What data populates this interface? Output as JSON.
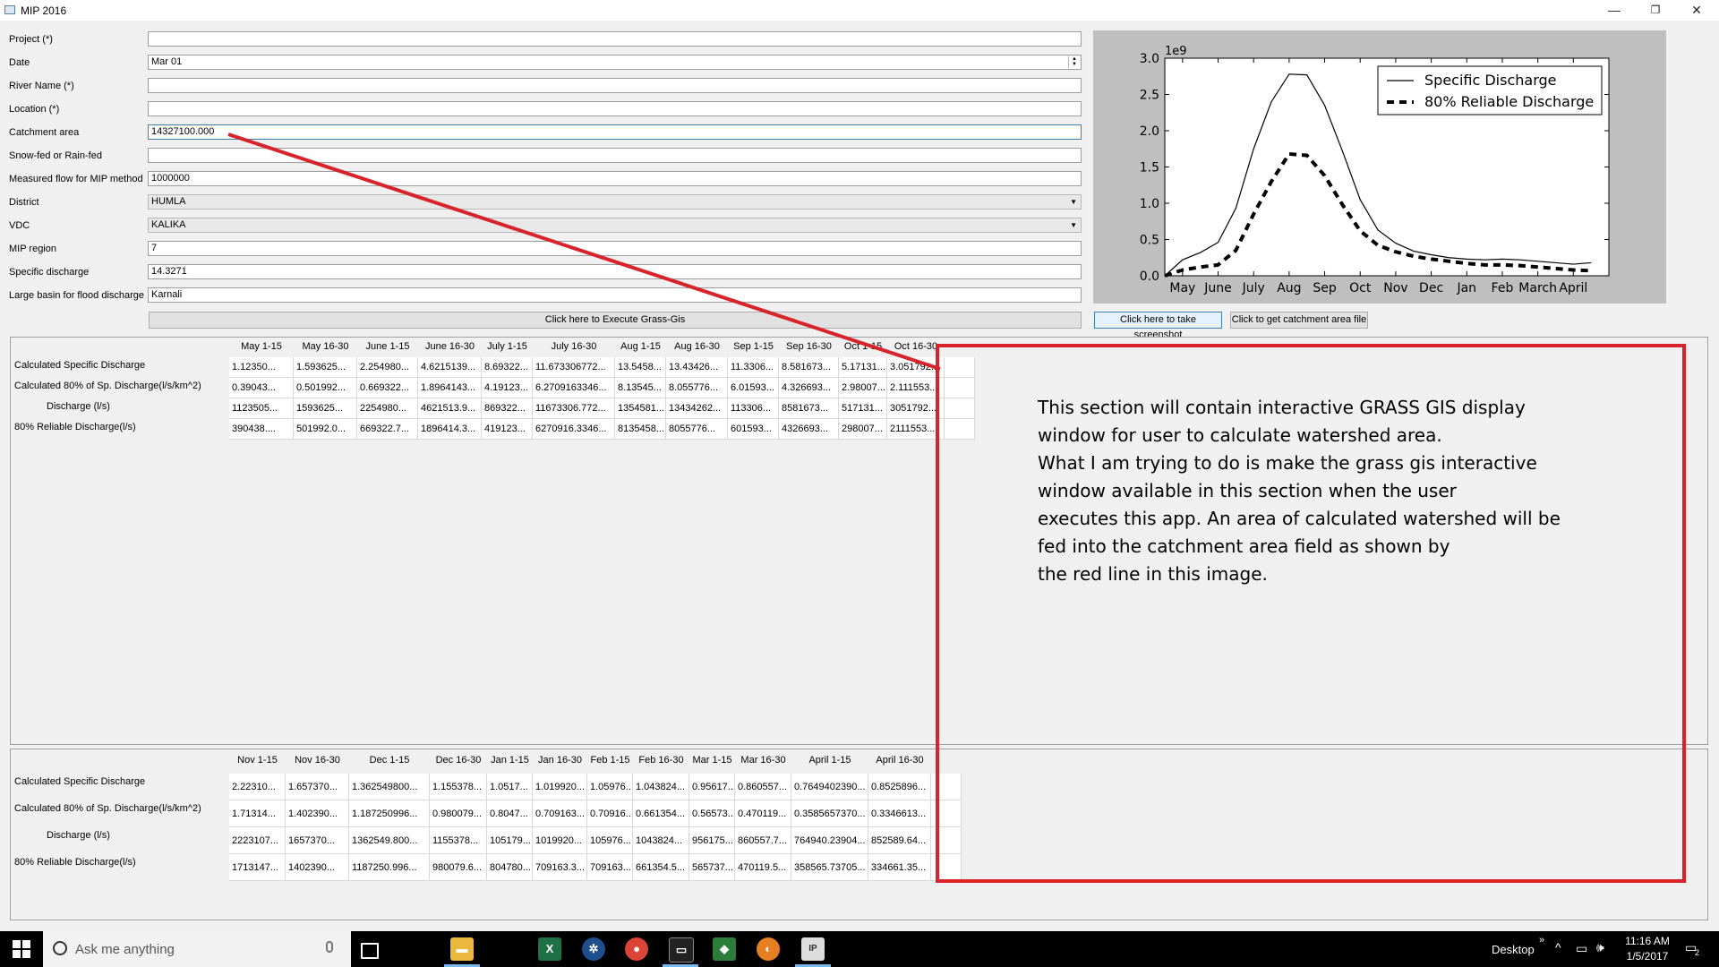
{
  "window": {
    "title": "MIP 2016",
    "minimize": "—",
    "restore": "❐",
    "close": "✕"
  },
  "form": {
    "project_label": "Project (*)",
    "project_value": "",
    "date_label": "Date",
    "date_value": "Mar 01",
    "river_label": "River Name (*)",
    "river_value": "",
    "location_label": "Location (*)",
    "location_value": "",
    "catchment_label": "Catchment area",
    "catchment_value": "14327100.000",
    "snowfed_label": "Snow-fed or Rain-fed",
    "snowfed_value": "",
    "measured_label": "Measured flow for MIP method",
    "measured_value": "1000000",
    "district_label": "District",
    "district_value": "HUMLA",
    "vdc_label": "VDC",
    "vdc_value": "KALIKA",
    "mip_label": "MIP region",
    "mip_value": "7",
    "specific_label": "Specific discharge",
    "specific_value": "14.3271",
    "basin_label": "Large basin for flood discharge",
    "basin_value": "Karnali"
  },
  "buttons": {
    "execute": "Click here to Execute Grass-Gis",
    "screenshot": "Click here to take screenshot",
    "catchment_file": "Click to get catchment area file"
  },
  "chart_data": {
    "type": "line",
    "title": "",
    "xlabel": "",
    "ylabel": "",
    "y_offset_label": "1e9",
    "categories": [
      "May",
      "June",
      "July",
      "Aug",
      "Sep",
      "Oct",
      "Nov",
      "Dec",
      "Jan",
      "Feb",
      "March",
      "April"
    ],
    "x_tick_positions": [
      1,
      3,
      5,
      7,
      9,
      11,
      13,
      15,
      17,
      19,
      21,
      23
    ],
    "y_ticks": [
      "0.0",
      "0.5",
      "1.0",
      "1.5",
      "2.0",
      "2.5",
      "3.0"
    ],
    "ylim": [
      0,
      3.0
    ],
    "xlim": [
      0,
      25
    ],
    "legend_position": "top-right",
    "series": [
      {
        "name": "Specific Discharge",
        "style": "solid",
        "x": [
          0,
          1,
          2,
          3,
          4,
          5,
          6,
          7,
          8,
          9,
          10,
          11,
          12,
          13,
          14,
          15,
          16,
          17,
          18,
          19,
          20,
          21,
          22,
          23,
          24
        ],
        "values": [
          0.0,
          0.22,
          0.32,
          0.46,
          0.93,
          1.75,
          2.4,
          2.78,
          2.77,
          2.35,
          1.72,
          1.05,
          0.63,
          0.45,
          0.34,
          0.29,
          0.25,
          0.23,
          0.22,
          0.23,
          0.22,
          0.2,
          0.18,
          0.16,
          0.18
        ]
      },
      {
        "name": "80% Reliable Discharge",
        "style": "dashed",
        "x": [
          0,
          1,
          2,
          3,
          4,
          5,
          6,
          7,
          8,
          9,
          10,
          11,
          12,
          13,
          14,
          15,
          16,
          17,
          18,
          19,
          20,
          21,
          22,
          23,
          24
        ],
        "values": [
          0.0,
          0.08,
          0.12,
          0.15,
          0.35,
          0.85,
          1.3,
          1.68,
          1.66,
          1.38,
          0.98,
          0.62,
          0.42,
          0.33,
          0.27,
          0.23,
          0.2,
          0.17,
          0.15,
          0.15,
          0.14,
          0.12,
          0.1,
          0.08,
          0.07
        ]
      }
    ]
  },
  "table1": {
    "columns": [
      "May 1-15",
      "May 16-30",
      "June 1-15",
      "June 16-30",
      "July 1-15",
      "July 16-30",
      "Aug 1-15",
      "Aug 16-30",
      "Sep 1-15",
      "Sep 16-30",
      "Oct 1-15",
      "Oct 16-30"
    ],
    "rows": [
      {
        "label": "Calculated Specific Discharge",
        "values": [
          "1.12350...",
          "1.593625...",
          "2.254980...",
          "4.6215139...",
          "8.69322...",
          "11.673306772...",
          "13.5458...",
          "13.43426...",
          "11.3306...",
          "8.581673...",
          "5.17131...",
          "3.051792..."
        ]
      },
      {
        "label": "Calculated 80% of Sp. Discharge(l/s/km^2)",
        "values": [
          "0.39043...",
          "0.501992...",
          "0.669322...",
          "1.8964143...",
          "4.19123...",
          "6.2709163346...",
          "8.13545...",
          "8.055776...",
          "6.01593...",
          "4.326693...",
          "2.98007...",
          "2.111553..."
        ]
      },
      {
        "label": "Discharge (l/s)",
        "values": [
          "1123505...",
          "1593625...",
          "2254980...",
          "4621513.9...",
          "869322...",
          "11673306.772...",
          "1354581...",
          "13434262...",
          "113306...",
          "8581673...",
          "517131...",
          "3051792..."
        ]
      },
      {
        "label": "80% Reliable Discharge(l/s)",
        "values": [
          "390438....",
          "501992.0...",
          "669322.7...",
          "1896414.3...",
          "419123...",
          "6270916.3346...",
          "8135458...",
          "8055776...",
          "601593...",
          "4326693...",
          "298007...",
          "2111553...."
        ]
      }
    ]
  },
  "table2": {
    "columns": [
      "Nov 1-15",
      "Nov 16-30",
      "Dec 1-15",
      "Dec 16-30",
      "Jan 1-15",
      "Jan 16-30",
      "Feb 1-15",
      "Feb 16-30",
      "Mar 1-15",
      "Mar 16-30",
      "April 1-15",
      "April 16-30"
    ],
    "rows": [
      {
        "label": "Calculated Specific Discharge",
        "values": [
          "2.22310...",
          "1.657370...",
          "1.362549800...",
          "1.155378...",
          "1.0517...",
          "1.019920...",
          "1.05976...",
          "1.043824...",
          "0.95617...",
          "0.860557...",
          "0.7649402390...",
          "0.8525896..."
        ]
      },
      {
        "label": "Calculated 80% of Sp. Discharge(l/s/km^2)",
        "values": [
          "1.71314...",
          "1.402390...",
          "1.187250996...",
          "0.980079...",
          "0.8047...",
          "0.709163...",
          "0.70916...",
          "0.661354...",
          "0.56573...",
          "0.470119...",
          "0.3585657370...",
          "0.3346613..."
        ]
      },
      {
        "label": "Discharge (l/s)",
        "values": [
          "2223107...",
          "1657370...",
          "1362549.800...",
          "1155378...",
          "105179...",
          "1019920...",
          "105976...",
          "1043824...",
          "956175...",
          "860557.7...",
          "764940.23904...",
          "852589.64..."
        ]
      },
      {
        "label": "80% Reliable Discharge(l/s)",
        "values": [
          "1713147...",
          "1402390...",
          "1187250.996...",
          "980079.6...",
          "804780...",
          "709163.3...",
          "709163...",
          "661354.5...",
          "565737...",
          "470119.5...",
          "358565.73705...",
          "334661.35..."
        ]
      }
    ]
  },
  "overlay": {
    "lines": [
      "This section will contain interactive GRASS GIS display",
      "window for user to calculate watershed area.",
      "What I am trying to do is make the grass gis interactive",
      "window available in this section when the user",
      "executes this app. An area of calculated watershed will be",
      "fed into the catchment area field as shown by",
      "the red line in this image."
    ],
    "color": "#d8232a"
  },
  "taskbar": {
    "search_placeholder": "Ask me anything",
    "desktop_label": "Desktop",
    "chevrons": "»",
    "time": "11:16 AM",
    "date": "1/5/2017",
    "notification": "2",
    "apps": [
      "task-view",
      "file-explorer",
      "excel",
      "app-blue",
      "chrome",
      "terminal",
      "app-green",
      "app-orange",
      "ipython"
    ]
  }
}
